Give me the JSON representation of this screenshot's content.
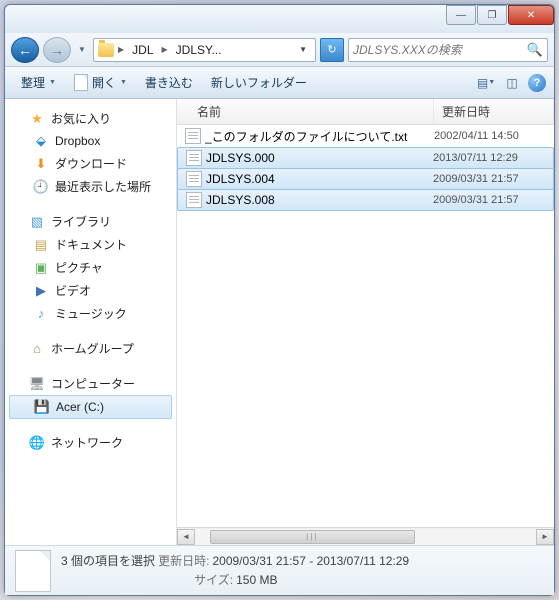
{
  "titlebar": {
    "min": "—",
    "max": "❐",
    "close": "✕"
  },
  "nav": {
    "back": "←",
    "fwd": "→"
  },
  "address": {
    "crumbs": [
      "JDL",
      "JDLSY..."
    ],
    "refresh": "↻"
  },
  "search": {
    "placeholder": "JDLSYS.XXXの検索",
    "icon": "🔍"
  },
  "toolbar": {
    "organize": "整理",
    "open": "開く",
    "write": "書き込む",
    "newfolder": "新しいフォルダー"
  },
  "navtree": {
    "fav": "お気に入り",
    "dropbox": "Dropbox",
    "downloads": "ダウンロード",
    "recent": "最近表示した場所",
    "lib": "ライブラリ",
    "docs": "ドキュメント",
    "pics": "ピクチャ",
    "vids": "ビデオ",
    "music": "ミュージック",
    "homegroup": "ホームグループ",
    "computer": "コンピューター",
    "cdrive": "Acer (C:)",
    "network": "ネットワーク"
  },
  "cols": {
    "name": "名前",
    "date": "更新日時"
  },
  "files": [
    {
      "name": "_このフォルダのファイルについて.txt",
      "date": "2002/04/11 14:50",
      "sel": false
    },
    {
      "name": "JDLSYS.000",
      "date": "2013/07/11 12:29",
      "sel": true
    },
    {
      "name": "JDLSYS.004",
      "date": "2009/03/31 21:57",
      "sel": true
    },
    {
      "name": "JDLSYS.008",
      "date": "2009/03/31 21:57",
      "sel": true
    }
  ],
  "status": {
    "selcount": "3 個の項目を選択",
    "mod_lbl": "更新日時:",
    "mod_val": "2009/03/31 21:57 - 2013/07/11 12:29",
    "size_lbl": "サイズ:",
    "size_val": "150 MB"
  }
}
